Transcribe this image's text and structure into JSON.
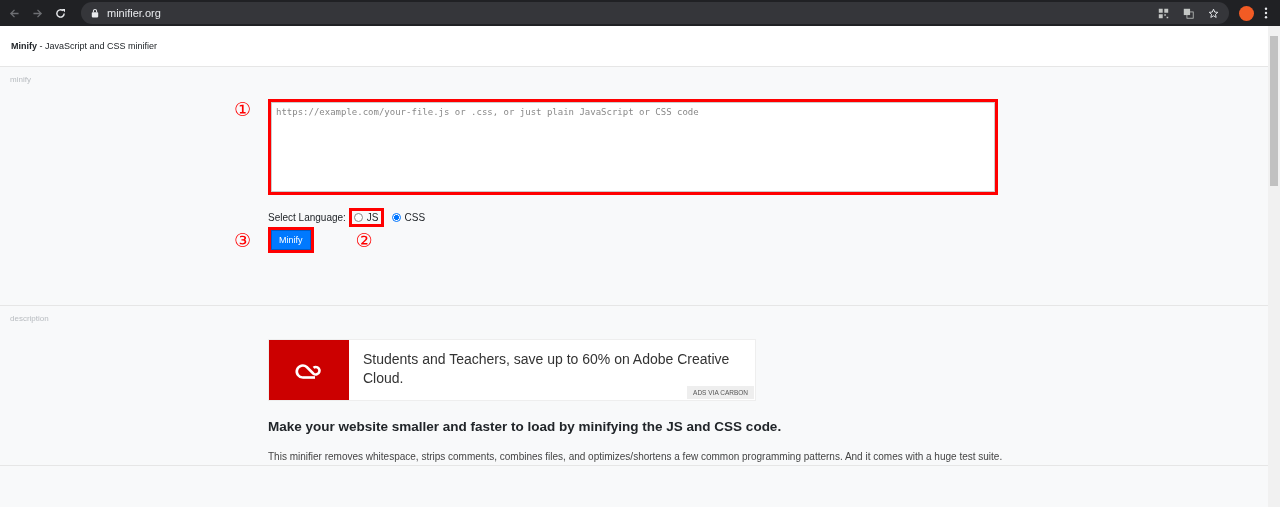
{
  "browser": {
    "url": "minifier.org"
  },
  "header": {
    "brand": "Minify",
    "tagline": "- JavaScript and CSS minifier"
  },
  "minify_section": {
    "label": "minify",
    "input": {
      "placeholder": "https://example.com/your-file.js or .css, or just plain JavaScript or CSS code",
      "marker": "①"
    },
    "language": {
      "label": "Select Language:",
      "marker": "②",
      "options": [
        {
          "label": "JS",
          "selected": false,
          "highlighted": true
        },
        {
          "label": "CSS",
          "selected": true,
          "highlighted": false
        }
      ]
    },
    "button": {
      "label": "Minify",
      "marker": "③"
    }
  },
  "description_section": {
    "label": "description",
    "ad": {
      "text": "Students and Teachers, save up to 60% on Adobe Creative Cloud.",
      "badge": "ADS VIA CARBON"
    },
    "heading": "Make your website smaller and faster to load by minifying the JS and CSS code.",
    "paragraph": "This minifier removes whitespace, strips comments, combines files, and optimizes/shortens a few common programming patterns. And it comes with a huge test suite."
  }
}
